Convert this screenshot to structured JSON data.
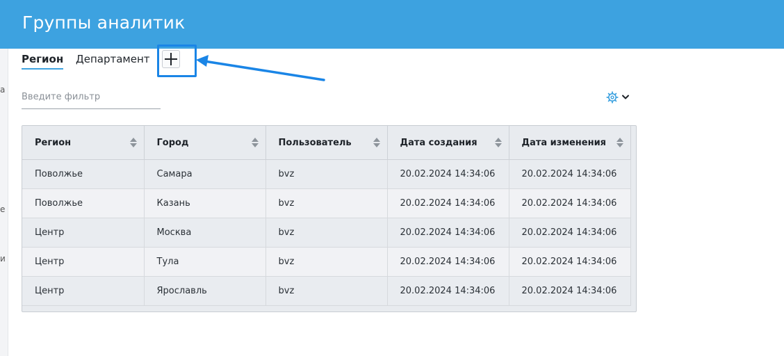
{
  "header": {
    "title": "Группы аналитик"
  },
  "left_strip": {
    "fragments": [
      "а",
      "е",
      "и"
    ]
  },
  "tabs": [
    {
      "label": "Регион",
      "active": true
    },
    {
      "label": "Департамент",
      "active": false
    }
  ],
  "add_tab": {
    "icon": "plus-icon"
  },
  "filter": {
    "placeholder": "Введите фильтр",
    "value": ""
  },
  "settings": {
    "icon": "gear-icon",
    "dropdown_icon": "chevron-down-icon"
  },
  "table": {
    "columns": [
      "Регион",
      "Город",
      "Пользователь",
      "Дата создания",
      "Дата изменения"
    ],
    "rows": [
      [
        "Поволжье",
        "Самара",
        "bvz",
        "20.02.2024 14:34:06",
        "20.02.2024 14:34:06"
      ],
      [
        "Поволжье",
        "Казань",
        "bvz",
        "20.02.2024 14:34:06",
        "20.02.2024 14:34:06"
      ],
      [
        "Центр",
        "Москва",
        "bvz",
        "20.02.2024 14:34:06",
        "20.02.2024 14:34:06"
      ],
      [
        "Центр",
        "Тула",
        "bvz",
        "20.02.2024 14:34:06",
        "20.02.2024 14:34:06"
      ],
      [
        "Центр",
        "Ярославль",
        "bvz",
        "20.02.2024 14:34:06",
        "20.02.2024 14:34:06"
      ]
    ]
  },
  "colors": {
    "header": "#3da2e0",
    "annotation": "#1a85e6"
  }
}
